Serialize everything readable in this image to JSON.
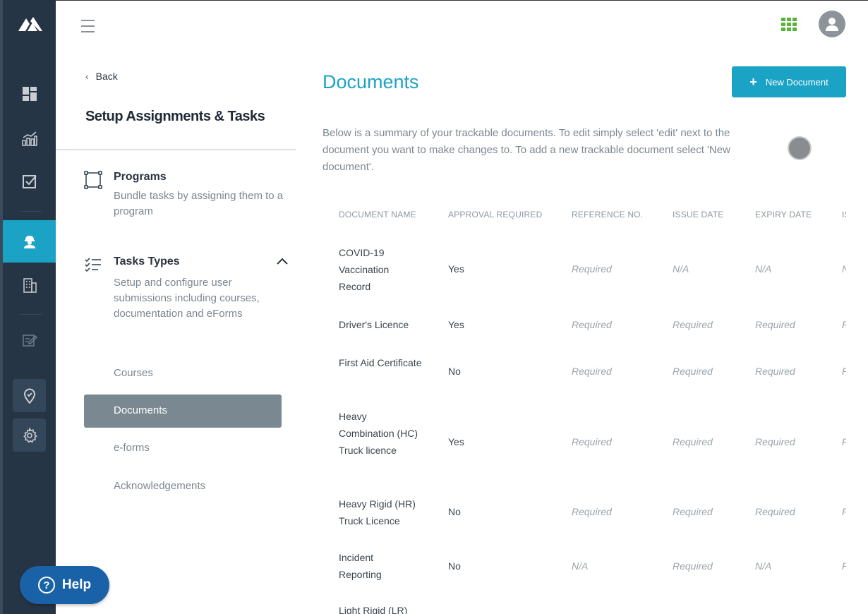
{
  "header": {
    "menu_icon": "hamburger-icon",
    "apps_icon": "apps-grid-icon",
    "avatar_icon": "user-avatar-icon"
  },
  "rail": {
    "items": [
      "dashboard-icon",
      "analytics-icon",
      "tasks-check-icon",
      "worker-icon",
      "building-icon",
      "edit-icon",
      "location-pin-icon",
      "settings-gear-icon"
    ],
    "active": "worker-icon",
    "accent": "#1ba3c6"
  },
  "subnav": {
    "back_label": "Back",
    "title": "Setup Assignments & Tasks",
    "programs": {
      "title": "Programs",
      "description": "Bundle tasks by assigning them to a program"
    },
    "task_types": {
      "title": "Tasks Types",
      "description": "Setup and configure user submissions including courses, documentation and eForms"
    },
    "links": [
      "Courses",
      "Documents",
      "e-forms",
      "Acknowledgements"
    ],
    "active_link": "Documents"
  },
  "help": {
    "label": "Help"
  },
  "main": {
    "title": "Documents",
    "new_button_label": "New Document",
    "intro": "Below is a summary of your trackable documents. To edit simply select 'edit' next to the document you want to make changes to. To add a new trackable document select 'New document'.",
    "columns": [
      "DOCUMENT NAME",
      "APPROVAL REQUIRED",
      "REFERENCE NO.",
      "ISSUE DATE",
      "EXPIRY DATE",
      "IS"
    ],
    "rows": [
      {
        "name": "COVID-19 Vaccination Record",
        "approval": "Yes",
        "reference": "Required",
        "issue": "N/A",
        "expiry": "N/A",
        "extra": "N"
      },
      {
        "name": "Driver's Licence",
        "approval": "Yes",
        "reference": "Required",
        "issue": "Required",
        "expiry": "Required",
        "extra": "R"
      },
      {
        "name": "First Aid Certificate",
        "approval": "No",
        "reference": "Required",
        "issue": "Required",
        "expiry": "Required",
        "extra": "R"
      },
      {
        "name": "Heavy Combination (HC) Truck licence",
        "approval": "Yes",
        "reference": "Required",
        "issue": "Required",
        "expiry": "Required",
        "extra": "R"
      },
      {
        "name": "Heavy Rigid (HR) Truck Licence",
        "approval": "No",
        "reference": "Required",
        "issue": "Required",
        "expiry": "Required",
        "extra": "R"
      },
      {
        "name": "Incident Reporting",
        "approval": "No",
        "reference": "N/A",
        "issue": "Required",
        "expiry": "N/A",
        "extra": "R"
      },
      {
        "name": "Light Rigid (LR)",
        "approval": "",
        "reference": "",
        "issue": "",
        "expiry": "",
        "extra": ""
      }
    ]
  }
}
